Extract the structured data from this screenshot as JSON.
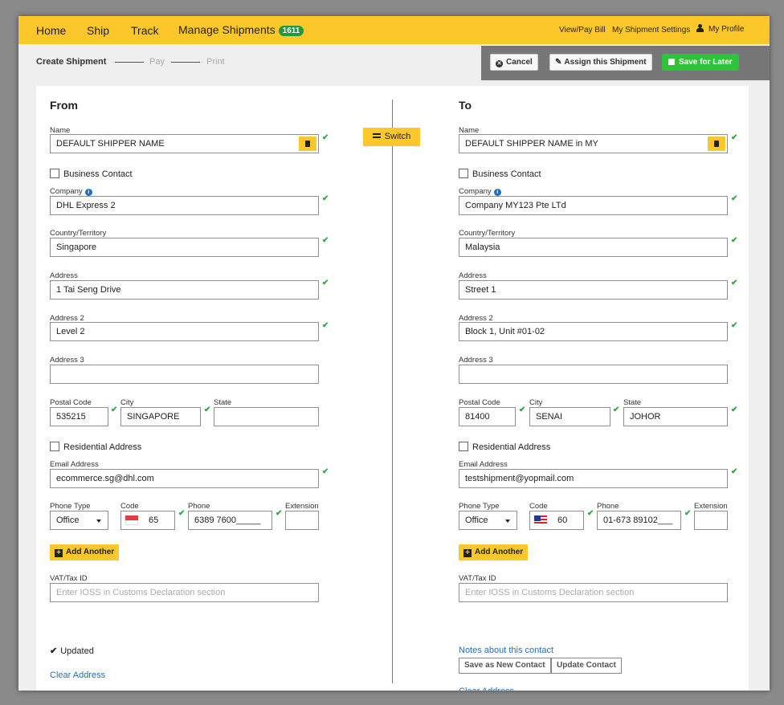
{
  "nav": {
    "home": "Home",
    "ship": "Ship",
    "track": "Track",
    "manage": "Manage Shipments",
    "manage_badge": "1611",
    "view_pay_bill": "View/Pay Bill",
    "shipment_settings": "My Shipment Settings",
    "my_profile": "My Profile"
  },
  "steps": {
    "create": "Create Shipment",
    "pay": "Pay",
    "print": "Print"
  },
  "actions": {
    "cancel": "Cancel",
    "assign": "Assign this Shipment",
    "save_later": "Save for Later"
  },
  "switch_label": "Switch",
  "labels": {
    "name": "Name",
    "business_contact": "Business Contact",
    "company": "Company",
    "country": "Country/Territory",
    "address": "Address",
    "address2": "Address 2",
    "address3": "Address 3",
    "postal_code": "Postal Code",
    "city": "City",
    "state": "State",
    "residential": "Residential Address",
    "email": "Email Address",
    "phone_type": "Phone Type",
    "code": "Code",
    "phone": "Phone",
    "extension": "Extension",
    "add_another": "Add Another",
    "vat": "VAT/Tax ID",
    "vat_placeholder": "Enter IOSS in Customs Declaration section",
    "clear_address": "Clear Address"
  },
  "from": {
    "title": "From",
    "name": "DEFAULT SHIPPER NAME",
    "company": "DHL Express 2",
    "country": "Singapore",
    "address": "1 Tai Seng Drive",
    "address2": "Level 2",
    "address3": "",
    "postal_code": "535215",
    "city": "SINGAPORE",
    "state": "",
    "email": "ecommerce.sg@dhl.com",
    "phone_type": "Office",
    "code": "65",
    "phone": "6389 7600_____",
    "extension": "",
    "updated": "Updated"
  },
  "to": {
    "title": "To",
    "name": "DEFAULT SHIPPER NAME in MY",
    "company": "Company MY123 Pte LTd",
    "country": "Malaysia",
    "address": "Street 1",
    "address2": "Block 1, Unit #01-02",
    "address3": "",
    "postal_code": "81400",
    "city": "SENAI",
    "state": "JOHOR",
    "email": "testshipment@yopmail.com",
    "phone_type": "Office",
    "code": "60",
    "phone": "01-673 89102___",
    "extension": "",
    "notes_link": "Notes about this contact",
    "save_new": "Save as New Contact",
    "update_contact": "Update Contact"
  },
  "colors": {
    "brand_yellow": "#fcc72a",
    "success_green": "#2ec33b",
    "link_blue": "#1f6fbf"
  }
}
